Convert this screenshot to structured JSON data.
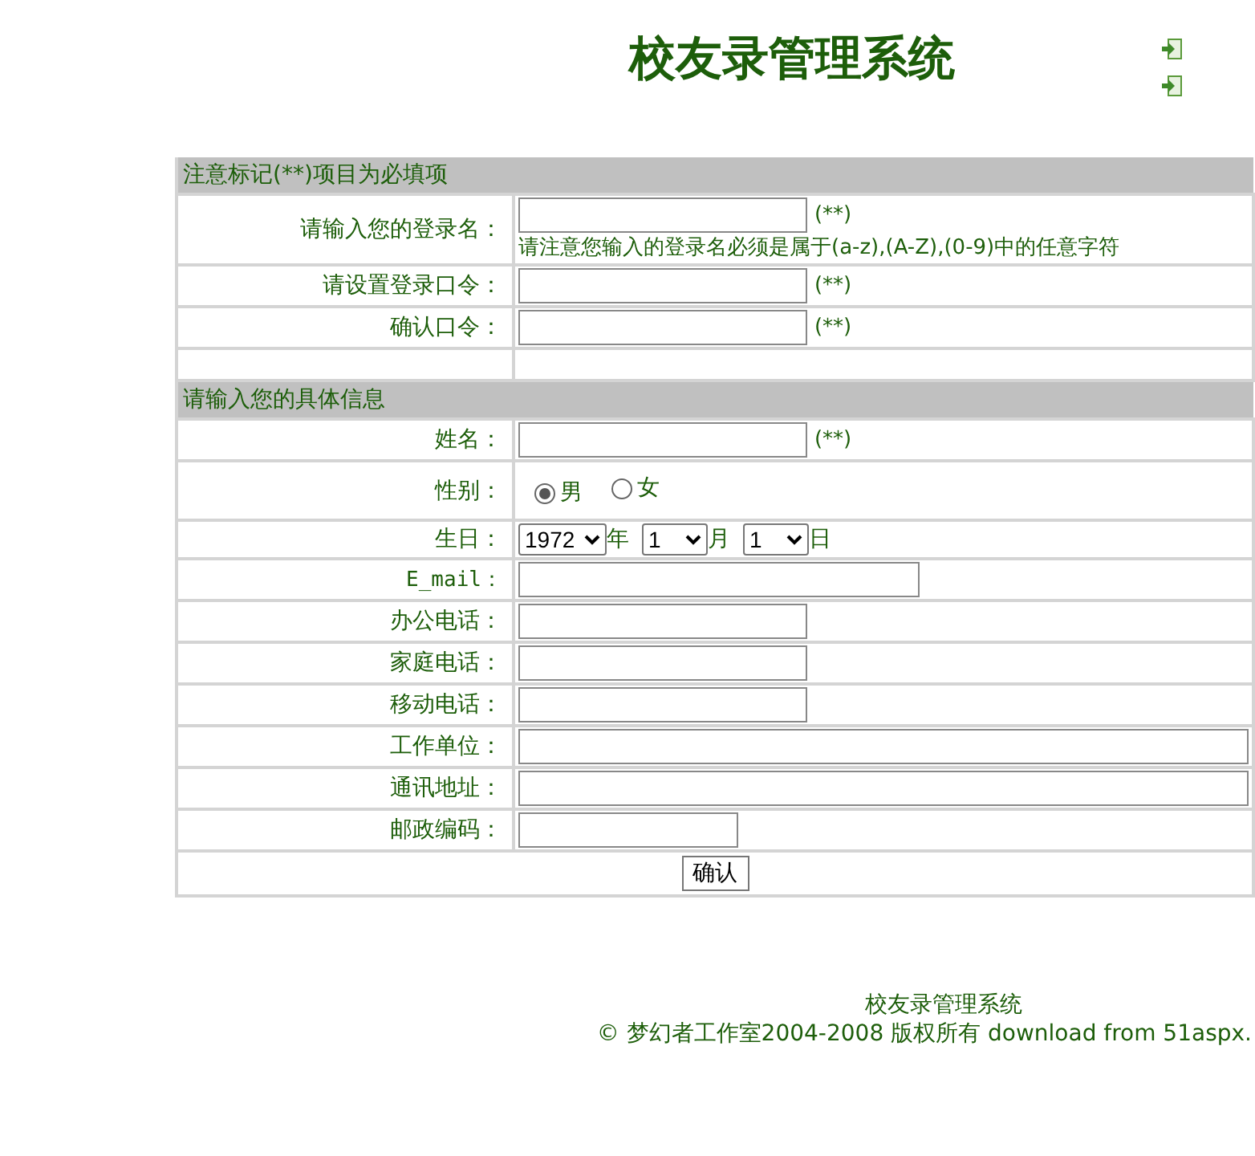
{
  "title": "校友录管理系统",
  "sections": [
    {
      "heading": "注意标记(**)项目为必填项",
      "rows": [
        {
          "kind": "text",
          "label": "请输入您的登录名：",
          "required_mark": "(**)",
          "note": "请注意您输入的登录名必须是属于(a-z),(A-Z),(0-9)中的任意字符"
        },
        {
          "kind": "password",
          "label": "请设置登录口令：",
          "required_mark": "(**)"
        },
        {
          "kind": "password",
          "label": "确认口令：",
          "required_mark": "(**)"
        },
        {
          "kind": "blank"
        }
      ]
    },
    {
      "heading": "请输入您的具体信息",
      "rows": [
        {
          "kind": "text",
          "label": "姓名：",
          "required_mark": "(**)"
        },
        {
          "kind": "radio",
          "label": "性别：",
          "options": [
            {
              "label": "男",
              "selected": true
            },
            {
              "label": "女",
              "selected": false
            }
          ]
        },
        {
          "kind": "date",
          "label": "生日：",
          "parts": [
            {
              "value": "1972",
              "unit": "年"
            },
            {
              "value": "1",
              "unit": "月"
            },
            {
              "value": "1",
              "unit": "日"
            }
          ]
        },
        {
          "kind": "email",
          "label": "E_mail："
        },
        {
          "kind": "text",
          "label": "办公电话："
        },
        {
          "kind": "text",
          "label": "家庭电话："
        },
        {
          "kind": "text",
          "label": "移动电话："
        },
        {
          "kind": "wide",
          "label": "工作单位："
        },
        {
          "kind": "wide",
          "label": "通讯地址："
        },
        {
          "kind": "postcode",
          "label": "邮政编码："
        }
      ]
    }
  ],
  "submit_button": "确认",
  "footer": {
    "title": "校友录管理系统",
    "copyright": "© 梦幻者工作室2004-2008 版权所有 download from 51aspx."
  }
}
